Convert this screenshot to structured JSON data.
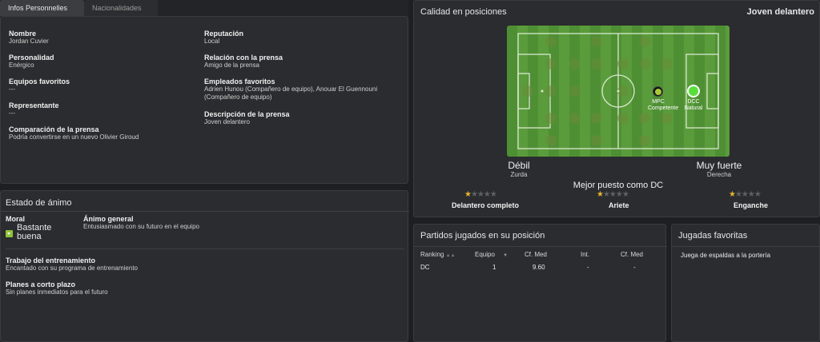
{
  "tabs": [
    {
      "label": "Infos Personnelles",
      "active": true
    },
    {
      "label": "Nacionalidades",
      "active": false
    }
  ],
  "personal": {
    "left": [
      {
        "label": "Nombre",
        "value": "Jordan Cuvier"
      },
      {
        "label": "Personalidad",
        "value": "Enérgico"
      },
      {
        "label": "Equipos favoritos",
        "value": "---"
      },
      {
        "label": "Representante",
        "value": "---"
      },
      {
        "label": "Comparación de la prensa",
        "value": "Podría convertirse en un nuevo Olivier Giroud"
      }
    ],
    "right": [
      {
        "label": "Reputación",
        "value": "Local"
      },
      {
        "label": "Relación con la prensa",
        "value": "Amigo de la prensa"
      },
      {
        "label": "Empleados favoritos",
        "value": "Adrien Hunou (Compañero de equipo), Anouar El Guennouni (Compañero de equipo)"
      },
      {
        "label": "Descripción de la prensa",
        "value": "Joven delantero"
      }
    ]
  },
  "mood": {
    "title": "Estado de ánimo",
    "morale_label": "Moral",
    "morale_value": "Bastante buena",
    "general_label": "Ánimo general",
    "general_value": "Entusiasmado con su futuro en el equipo",
    "training_label": "Trabajo del entrenamiento",
    "training_value": "Encantado con su programa de entrenamiento",
    "plans_label": "Planes a corto plazo",
    "plans_value": "Sin planes inmediatos para el futuro"
  },
  "positions": {
    "title": "Calidad en posiciones",
    "role": "Joven delantero",
    "markers": [
      {
        "code": "MPC",
        "rating": "Competente",
        "color": "#a9c93a"
      },
      {
        "code": "DCC",
        "rating": "Natural",
        "color": "#57e03a"
      }
    ],
    "left_foot_rating": "Débil",
    "left_foot_label": "Zurda",
    "right_foot_rating": "Muy fuerte",
    "right_foot_label": "Derecha",
    "best_role": "Mejor puesto como DC",
    "roles": [
      {
        "name": "Delantero completo",
        "stars": 1
      },
      {
        "name": "Ariete",
        "stars": 1
      },
      {
        "name": "Enganche",
        "stars": 1
      }
    ]
  },
  "matches": {
    "title": "Partidos jugados en su posición",
    "headers": [
      "Ranking",
      "Equipo",
      "Cf. Med",
      "Int.",
      "Cf. Med"
    ],
    "rows": [
      [
        "DC",
        "1",
        "9.60",
        "-",
        "-"
      ]
    ]
  },
  "favorite_moves": {
    "title": "Jugadas favoritas",
    "items": [
      "Juega de espaldas a la portería"
    ]
  }
}
